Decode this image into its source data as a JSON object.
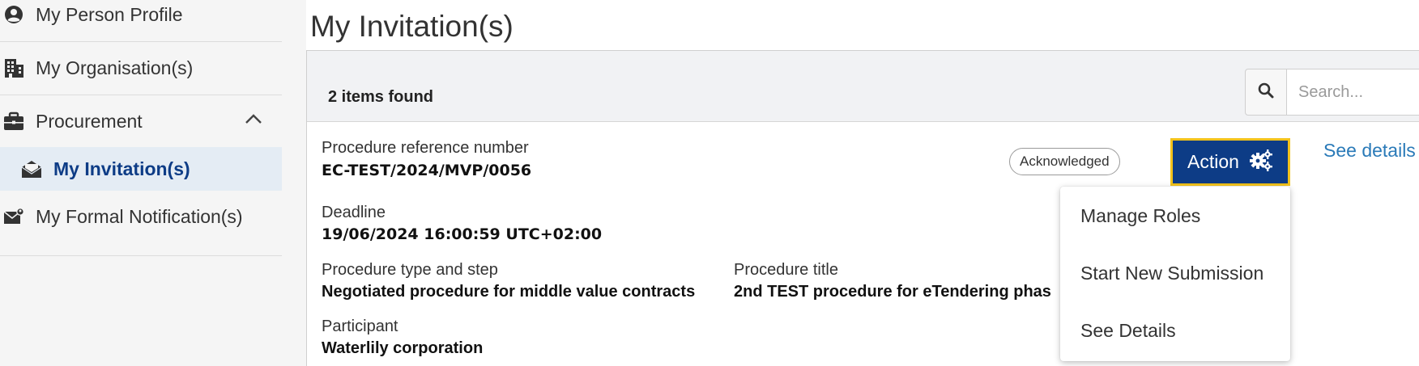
{
  "sidebar": {
    "items": [
      {
        "label": "My Person Profile",
        "icon": "person-circle-icon"
      },
      {
        "label": "My Organisation(s)",
        "icon": "building-icon"
      },
      {
        "label": "Procurement",
        "icon": "briefcase-icon"
      },
      {
        "label": "My Invitation(s)",
        "icon": "envelope-open-icon"
      },
      {
        "label": "My Formal Notification(s)",
        "icon": "envelope-person-icon"
      }
    ]
  },
  "page": {
    "title": "My Invitation(s)"
  },
  "list": {
    "count_text": "2 items found",
    "search_placeholder": "Search..."
  },
  "invitation": {
    "ref_label": "Procedure reference number",
    "ref_value": "EC-TEST/2024/MVP/0056",
    "status": "Acknowledged",
    "deadline_label": "Deadline",
    "deadline_value": "19/06/2024 16:00:59 UTC+02:00",
    "type_label": "Procedure type and step",
    "type_value": "Negotiated procedure for middle value contracts",
    "title_label": "Procedure title",
    "title_value": "2nd TEST procedure for eTendering phas",
    "participant_label": "Participant",
    "participant_value": "Waterlily corporation",
    "action_label": "Action",
    "see_details_link": "See details"
  },
  "action_menu": {
    "items": [
      "Manage Roles",
      "Start New Submission",
      "See Details"
    ]
  },
  "colors": {
    "primary": "#0d3c86",
    "focus_border": "#f2c21b",
    "link": "#2a7ab8",
    "active_bg": "#e4ecf4"
  }
}
